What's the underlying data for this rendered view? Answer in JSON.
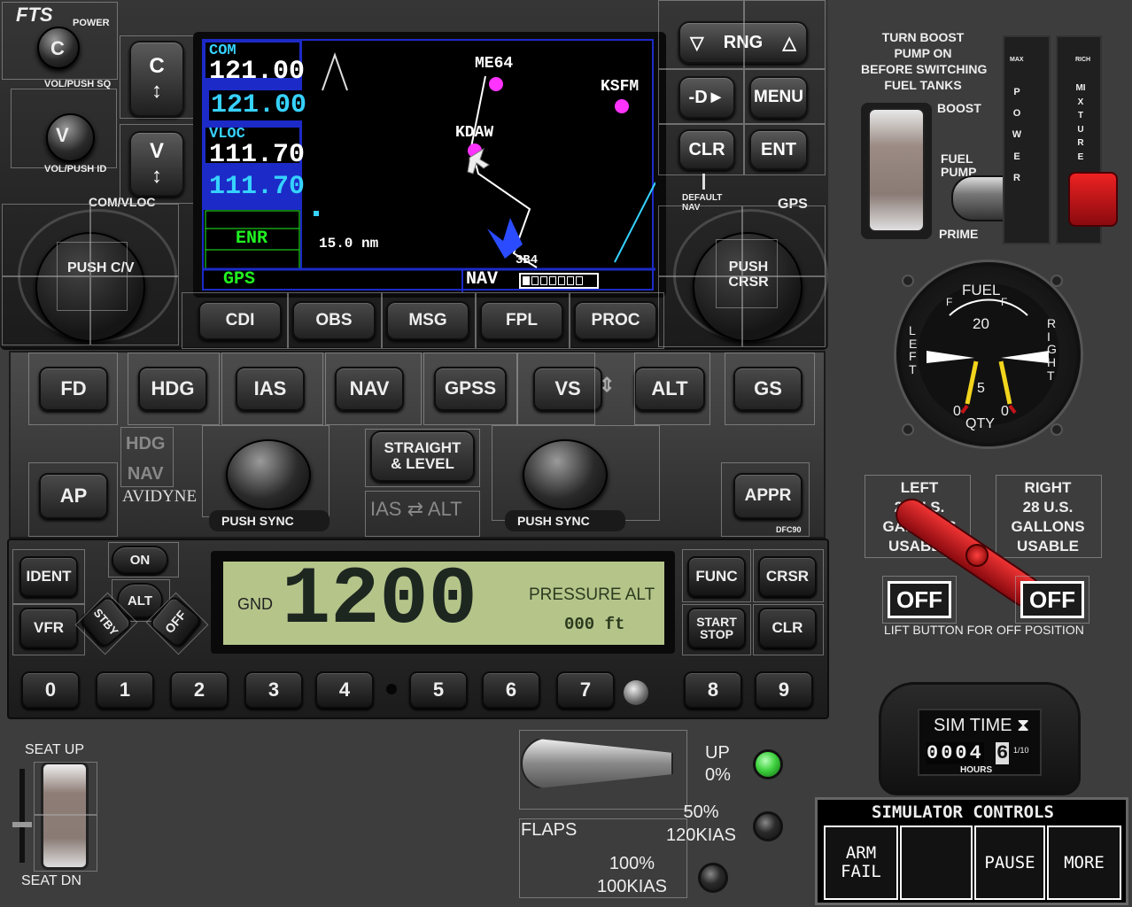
{
  "gps": {
    "brand": "FTS",
    "power_label": "POWER",
    "knob_c": "C",
    "knob_v": "V",
    "vol_push_sq": "VOL/PUSH SQ",
    "vol_push_id": "VOL/PUSH ID",
    "com_vloc": "COM/VLOC",
    "push_cv": "PUSH C/V",
    "com_label": "COM",
    "com_active": "121.00",
    "com_standby": "121.00",
    "vloc_label": "VLOC",
    "vloc_active": "111.70",
    "vloc_standby": "111.70",
    "enr": "ENR",
    "gps_label": "GPS",
    "range": "15.0 nm",
    "nav_label": "NAV",
    "map_points": [
      "ME64",
      "KSFM",
      "KDAW",
      "3B4"
    ],
    "rng_label": "RNG",
    "menu_label": "MENU",
    "clr_label": "CLR",
    "ent_label": "ENT",
    "default_nav": "DEFAULT NAV",
    "gps_right": "GPS",
    "push_crsr": "PUSH CRSR",
    "soft_keys": [
      "CDI",
      "OBS",
      "MSG",
      "FPL",
      "PROC"
    ]
  },
  "autopilot": {
    "modes": [
      "FD",
      "HDG",
      "IAS",
      "NAV",
      "GPSS",
      "VS",
      "ALT",
      "GS"
    ],
    "ap_label": "AP",
    "hdg_small": "HDG",
    "nav_small": "NAV",
    "brand": "AVIDYNE",
    "push_sync": "PUSH SYNC",
    "straight_level_1": "STRAIGHT",
    "straight_level_2": "& LEVEL",
    "ias_alt_1": "IAS",
    "ias_alt_2": "ALT",
    "appr_label": "APPR",
    "model": "DFC90"
  },
  "transponder": {
    "ident": "IDENT",
    "vfr": "VFR",
    "on": "ON",
    "alt": "ALT",
    "stby": "STBY",
    "off": "OFF",
    "mode": "GND",
    "code": "1200",
    "pressure_alt_label": "PRESSURE ALT",
    "pressure_alt_value": "000 ft",
    "func": "FUNC",
    "crsr": "CRSR",
    "start_stop_1": "START",
    "start_stop_2": "STOP",
    "clr": "CLR",
    "digits": [
      "0",
      "1",
      "2",
      "3",
      "4",
      "5",
      "6",
      "7",
      "8",
      "9"
    ]
  },
  "fuel": {
    "boost_note_1": "TURN BOOST",
    "boost_note_2": "PUMP ON",
    "boost_note_3": "BEFORE SWITCHING",
    "boost_note_4": "FUEL TANKS",
    "boost": "BOOST",
    "fuel_pump_1": "FUEL",
    "fuel_pump_2": "PUMP",
    "prime": "PRIME",
    "max": "MAX",
    "power": "POWER",
    "rich": "RICH",
    "mixture": "MIXTURE",
    "gauge_title": "FUEL",
    "gauge_left": "LEFT",
    "gauge_right": "RIGHT",
    "gauge_qty": "QTY",
    "gauge_20": "20",
    "gauge_5": "5",
    "gauge_0a": "0",
    "gauge_0b": "0",
    "gauge_f1": "F",
    "gauge_f2": "F",
    "left_tank_1": "LEFT",
    "left_tank_2": "28 U.S.",
    "left_tank_3": "GALLONS",
    "left_tank_4": "USABLE",
    "right_tank_1": "RIGHT",
    "right_tank_2": "28 U.S.",
    "right_tank_3": "GALLONS",
    "right_tank_4": "USABLE",
    "off_left": "OFF",
    "off_right": "OFF",
    "lift_note": "LIFT BUTTON FOR OFF POSITION"
  },
  "hobbs": {
    "label": "SIM TIME",
    "digits": "0004",
    "last_digit": "6",
    "fraction": "1/10",
    "unit": "HOURS"
  },
  "seat": {
    "up": "SEAT UP",
    "dn": "SEAT DN"
  },
  "flaps": {
    "label": "FLAPS",
    "up_1": "UP",
    "up_2": "0%",
    "mid_1": "50%",
    "mid_2": "120KIAS",
    "full_1": "100%",
    "full_2": "100KIAS",
    "indicator_colors": [
      "#3fd23f",
      "#2a2a2a",
      "#2a2a2a"
    ]
  },
  "sim_controls": {
    "title": "SIMULATOR CONTROLS",
    "arm_fail_1": "ARM",
    "arm_fail_2": "FAIL",
    "pause": "PAUSE",
    "more": "MORE"
  },
  "colors": {
    "lcd": "#b5c58a",
    "gps_cyan": "#36d2ff",
    "gps_green": "#21f221",
    "waypoint": "#ff33ff",
    "selector_red": "#c4141a"
  }
}
